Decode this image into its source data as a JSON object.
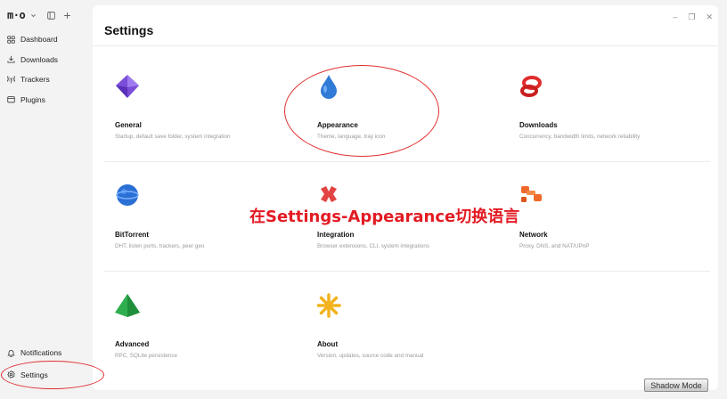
{
  "app": {
    "logo": "m·o",
    "page_title": "Settings"
  },
  "sidebar": {
    "items": [
      {
        "label": "Dashboard",
        "icon": "dashboard-icon"
      },
      {
        "label": "Downloads",
        "icon": "download-icon"
      },
      {
        "label": "Trackers",
        "icon": "tracker-icon"
      },
      {
        "label": "Plugins",
        "icon": "plugin-icon"
      }
    ],
    "bottom": [
      {
        "label": "Notifications",
        "icon": "bell-icon"
      },
      {
        "label": "Settings",
        "icon": "gear-icon"
      }
    ]
  },
  "window_controls": {
    "minimize": "–",
    "maximize": "❐",
    "close": "✕"
  },
  "cards": [
    {
      "title": "General",
      "desc": "Startup, default save folder, system integration",
      "icon": "purple-diamond-icon",
      "color": "#7b4dd8"
    },
    {
      "title": "Appearance",
      "desc": "Theme, language, tray icon",
      "icon": "water-drop-icon",
      "color": "#2f7bd6"
    },
    {
      "title": "Downloads",
      "desc": "Concurrency, bandwidth limits, network reliability",
      "icon": "red-knot-icon",
      "color": "#e02c2c"
    },
    {
      "title": "BitTorrent",
      "desc": "DHT, listen ports, trackers, peer geo",
      "icon": "blue-globe-icon",
      "color": "#2a6fd4"
    },
    {
      "title": "Integration",
      "desc": "Browser extensions, CLI, system integrations",
      "icon": "red-cross-icon",
      "color": "#e24444"
    },
    {
      "title": "Network",
      "desc": "Proxy, DNS, and NAT/UPnP",
      "icon": "orange-connector-icon",
      "color": "#ef6a2a"
    },
    {
      "title": "Advanced",
      "desc": "RPC, SQLite persistence",
      "icon": "green-pyramid-icon",
      "color": "#2fae4f"
    },
    {
      "title": "About",
      "desc": "Version, updates, source code and manual",
      "icon": "star-burst-icon",
      "color": "#f2b21c"
    }
  ],
  "annotation": {
    "text": "在Settings-Appearance切换语言",
    "color": "#e31b23"
  },
  "shadow_mode": {
    "label": "Shadow Mode"
  }
}
